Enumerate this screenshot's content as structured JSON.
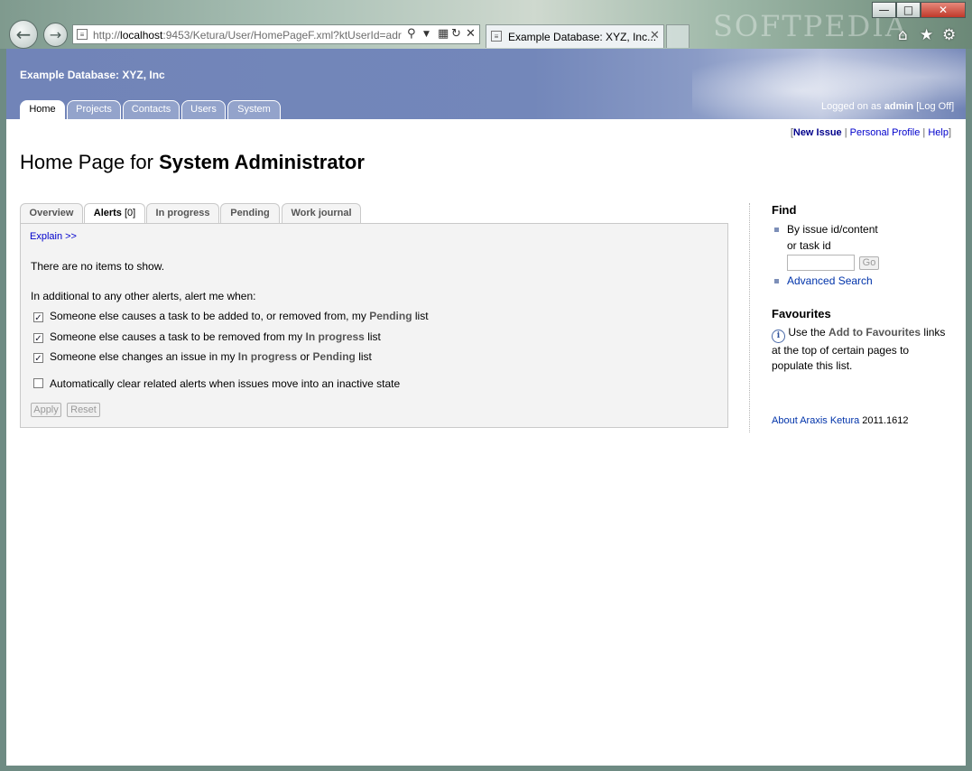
{
  "browser": {
    "url_prefix": "http://",
    "url_host": "localhost",
    "url_rest": ":9453/Ketura/User/HomePageF.xml?ktUserId=adr",
    "tab_title": "Example Database: XYZ, Inc...",
    "watermark": "SOFTPEDIA"
  },
  "banner": {
    "db_name": "Example Database: XYZ, Inc",
    "logged_prefix": "Logged on as",
    "user": "admin",
    "logoff": "Log Off",
    "tabs": [
      "Home",
      "Projects",
      "Contacts",
      "Users",
      "System"
    ]
  },
  "toplinks": {
    "new_issue": "New Issue",
    "profile": "Personal Profile",
    "help": "Help"
  },
  "title": {
    "prefix": "Home Page for",
    "role": "System Administrator"
  },
  "content_tabs": {
    "overview": "Overview",
    "alerts": "Alerts",
    "alerts_count": "[0]",
    "in_progress": "In progress",
    "pending": "Pending",
    "work_journal": "Work journal"
  },
  "alerts": {
    "explain": "Explain >>",
    "no_items": "There are no items to show.",
    "intro": "In additional to any other alerts, alert me when:",
    "opt1_a": "Someone else causes a task to be added to, or removed from, my",
    "opt1_b": "Pending",
    "opt1_c": "list",
    "opt2_a": "Someone else causes a task to be removed from my",
    "opt2_b": "In progress",
    "opt2_c": "list",
    "opt3_a": "Someone else changes an issue in my",
    "opt3_b": "In progress",
    "opt3_c": "or",
    "opt3_d": "Pending",
    "opt3_e": "list",
    "opt4": "Automatically clear related alerts when issues move into an inactive state",
    "apply": "Apply",
    "reset": "Reset"
  },
  "sidebar": {
    "find_heading": "Find",
    "find_by_1": "By issue id/content",
    "find_by_2": "or task id",
    "go": "Go",
    "advanced": "Advanced Search",
    "fav_heading": "Favourites",
    "fav_a": "Use the",
    "fav_b": "Add to Favourites",
    "fav_c": "links at the top of certain pages to populate this list.",
    "about_link": "About Araxis Ketura",
    "version": "2011.1612"
  }
}
